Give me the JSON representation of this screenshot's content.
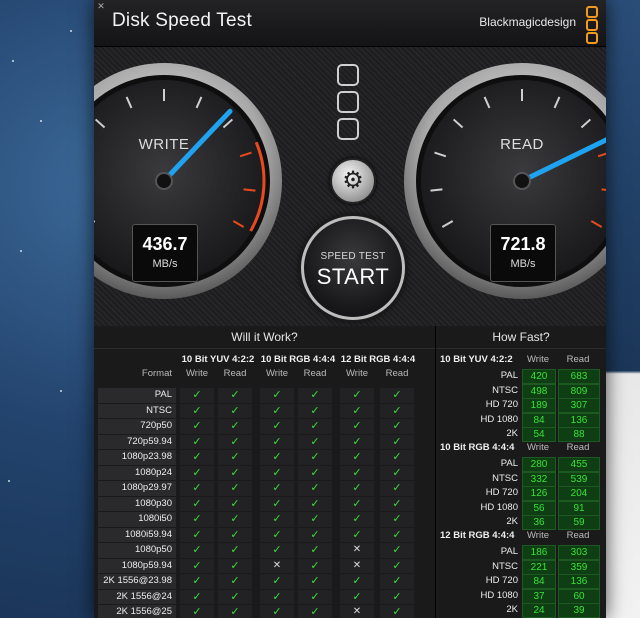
{
  "app": {
    "title": "Disk Speed Test",
    "brand": "Blackmagicdesign",
    "accent_color": "#f39a1e",
    "needle_color": "#1fa3f0"
  },
  "gauges": {
    "write": {
      "label": "WRITE",
      "value": "436.7",
      "unit": "MB/s"
    },
    "read": {
      "label": "READ",
      "value": "721.8",
      "unit": "MB/s"
    }
  },
  "controls": {
    "start_line1": "SPEED TEST",
    "start_line2": "START",
    "settings_icon": "gear-icon",
    "preset_icons": [
      "preset-1-icon",
      "preset-2-icon",
      "preset-3-icon"
    ]
  },
  "will_it_work": {
    "title": "Will it Work?",
    "format_header": "Format",
    "groups": [
      "10 Bit YUV 4:2:2",
      "10 Bit RGB 4:4:4",
      "12 Bit RGB 4:4:4"
    ],
    "subheaders": [
      "Write",
      "Read",
      "Write",
      "Read",
      "Write",
      "Read"
    ],
    "check_glyph": "✓",
    "cross_glyph": "✕",
    "rows": [
      {
        "format": "PAL",
        "results": [
          1,
          1,
          1,
          1,
          1,
          1
        ]
      },
      {
        "format": "NTSC",
        "results": [
          1,
          1,
          1,
          1,
          1,
          1
        ]
      },
      {
        "format": "720p50",
        "results": [
          1,
          1,
          1,
          1,
          1,
          1
        ]
      },
      {
        "format": "720p59.94",
        "results": [
          1,
          1,
          1,
          1,
          1,
          1
        ]
      },
      {
        "format": "1080p23.98",
        "results": [
          1,
          1,
          1,
          1,
          1,
          1
        ]
      },
      {
        "format": "1080p24",
        "results": [
          1,
          1,
          1,
          1,
          1,
          1
        ]
      },
      {
        "format": "1080p29.97",
        "results": [
          1,
          1,
          1,
          1,
          1,
          1
        ]
      },
      {
        "format": "1080p30",
        "results": [
          1,
          1,
          1,
          1,
          1,
          1
        ]
      },
      {
        "format": "1080i50",
        "results": [
          1,
          1,
          1,
          1,
          1,
          1
        ]
      },
      {
        "format": "1080i59.94",
        "results": [
          1,
          1,
          1,
          1,
          1,
          1
        ]
      },
      {
        "format": "1080p50",
        "results": [
          1,
          1,
          1,
          1,
          0,
          1
        ]
      },
      {
        "format": "1080p59.94",
        "results": [
          1,
          1,
          0,
          1,
          0,
          1
        ]
      },
      {
        "format": "2K 1556@23.98",
        "results": [
          1,
          1,
          1,
          1,
          1,
          1
        ]
      },
      {
        "format": "2K 1556@24",
        "results": [
          1,
          1,
          1,
          1,
          1,
          1
        ]
      },
      {
        "format": "2K 1556@25",
        "results": [
          1,
          1,
          1,
          1,
          0,
          1
        ]
      }
    ]
  },
  "how_fast": {
    "title": "How Fast?",
    "col_write": "Write",
    "col_read": "Read",
    "groups": [
      {
        "name": "10 Bit YUV 4:2:2",
        "rows": [
          {
            "format": "PAL",
            "write": "420",
            "read": "683"
          },
          {
            "format": "NTSC",
            "write": "498",
            "read": "809"
          },
          {
            "format": "HD 720",
            "write": "189",
            "read": "307"
          },
          {
            "format": "HD 1080",
            "write": "84",
            "read": "136"
          },
          {
            "format": "2K",
            "write": "54",
            "read": "88"
          }
        ]
      },
      {
        "name": "10 Bit RGB 4:4:4",
        "rows": [
          {
            "format": "PAL",
            "write": "280",
            "read": "455"
          },
          {
            "format": "NTSC",
            "write": "332",
            "read": "539"
          },
          {
            "format": "HD 720",
            "write": "126",
            "read": "204"
          },
          {
            "format": "HD 1080",
            "write": "56",
            "read": "91"
          },
          {
            "format": "2K",
            "write": "36",
            "read": "59"
          }
        ]
      },
      {
        "name": "12 Bit RGB 4:4:4",
        "rows": [
          {
            "format": "PAL",
            "write": "186",
            "read": "303"
          },
          {
            "format": "NTSC",
            "write": "221",
            "read": "359"
          },
          {
            "format": "HD 720",
            "write": "84",
            "read": "136"
          },
          {
            "format": "HD 1080",
            "write": "37",
            "read": "60"
          },
          {
            "format": "2K",
            "write": "24",
            "read": "39"
          }
        ]
      }
    ]
  }
}
